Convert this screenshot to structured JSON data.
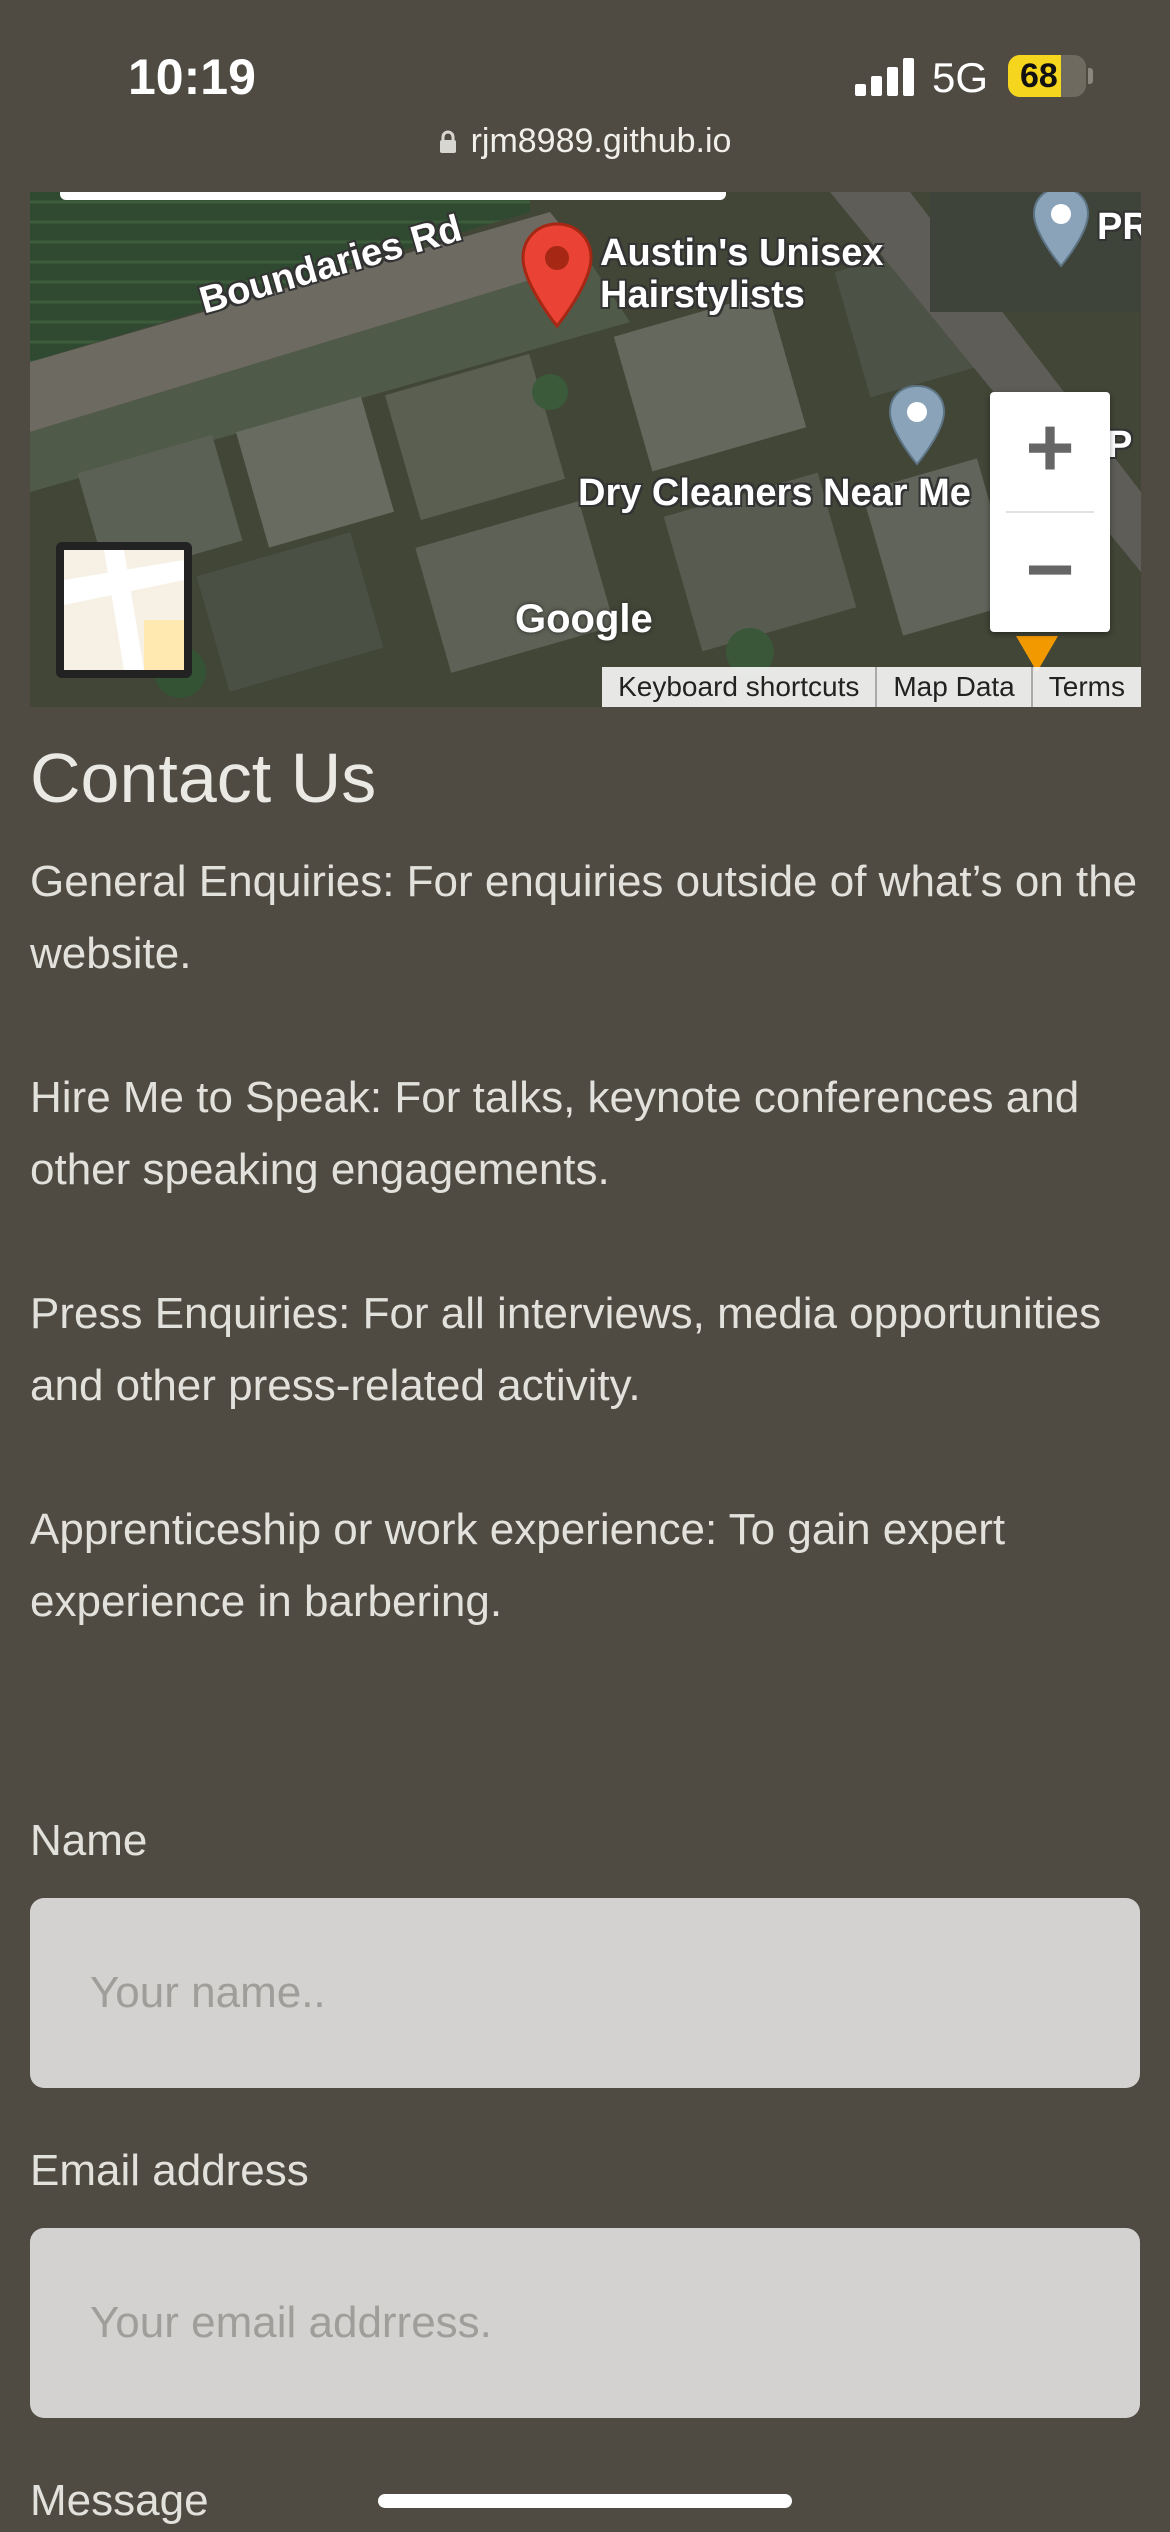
{
  "status_bar": {
    "time": "10:19",
    "network": "5G",
    "battery_level": "68",
    "battery_fraction": 0.68
  },
  "browser": {
    "url": "rjm8989.github.io"
  },
  "map": {
    "road_label": "Boundaries Rd",
    "poi_primary": [
      "Austin's Unisex",
      "Hairstylists"
    ],
    "poi_secondary": "Dry Cleaners Near Me",
    "poi_edge_1": "PR",
    "poi_edge_2": "P",
    "logo": "Google",
    "zoom_in": "+",
    "zoom_out": "−",
    "footer": {
      "keyboard_shortcuts": "Keyboard shortcuts",
      "map_data": "Map Data",
      "terms": "Terms"
    },
    "colors": {
      "pin_red": "#ea4335",
      "pin_blue_grey": "#8aa3b8",
      "pin_orange": "#f29900"
    }
  },
  "content": {
    "title": "Contact Us",
    "paragraphs": [
      "General Enquiries: For enquiries outside of what’s on the website.",
      "Hire Me to Speak: For talks, keynote conferences and other speaking engagements.",
      "Press Enquiries: For all interviews, media opportunities and other press-related activity.",
      "Apprenticeship or work experience: To gain expert experience in barbering."
    ]
  },
  "form": {
    "name_label": "Name",
    "name_placeholder": "Your name..",
    "email_label": "Email address",
    "email_placeholder": "Your email addrress.",
    "message_label": "Message"
  },
  "colors": {
    "page_background": "#4f4b42",
    "input_background": "#d3d2d0",
    "battery_yellow": "#f5d51e"
  }
}
